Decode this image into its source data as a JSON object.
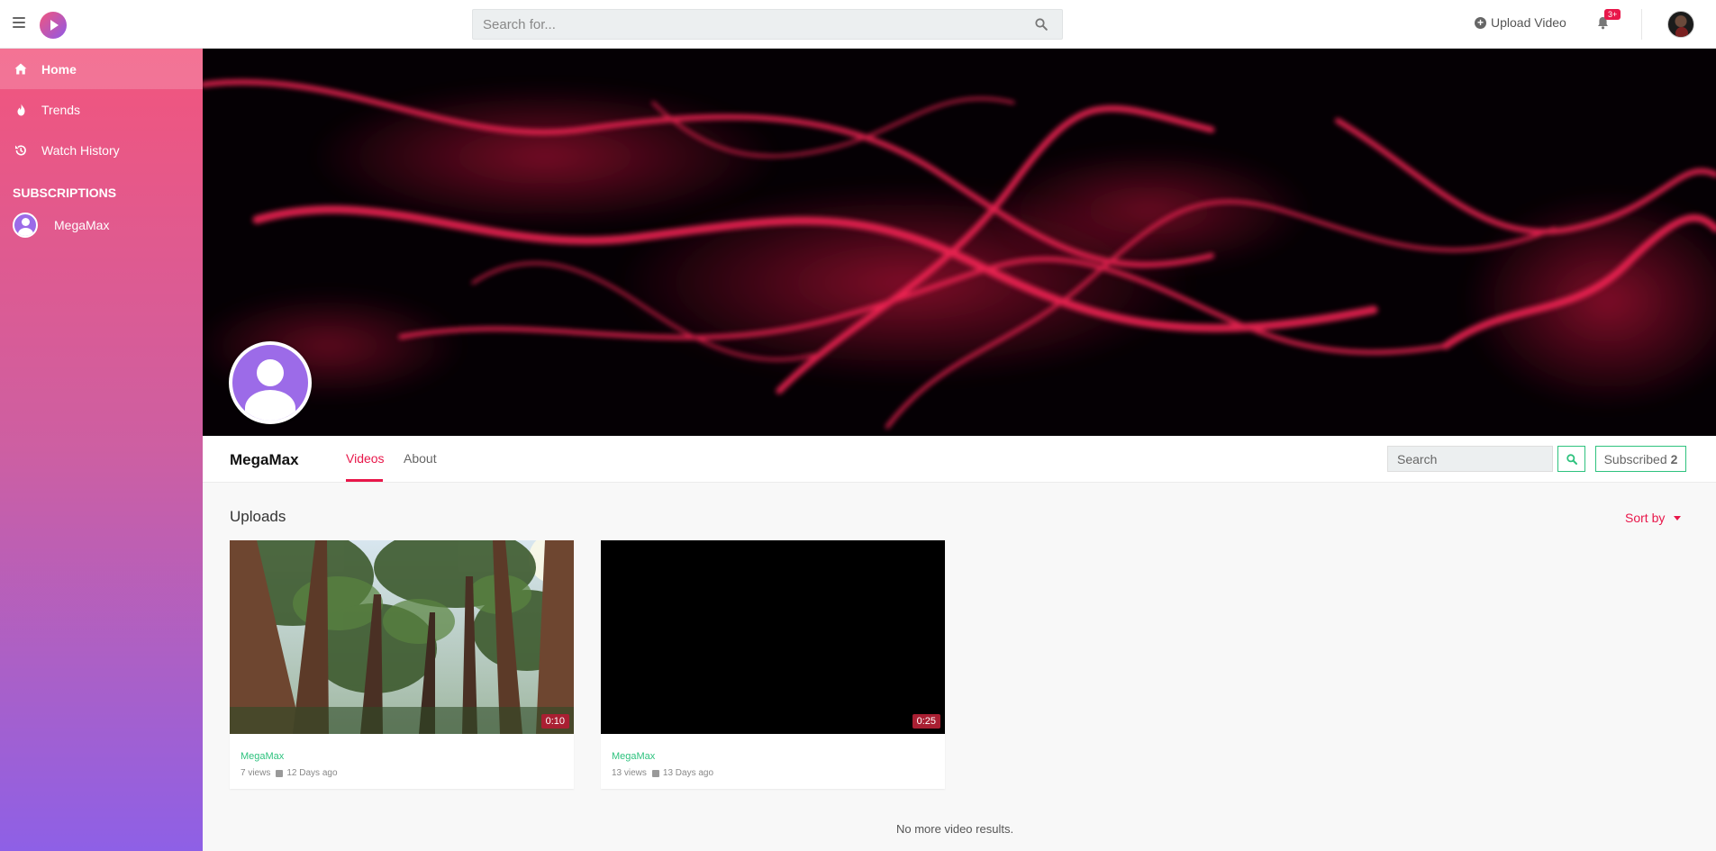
{
  "topbar": {
    "search_placeholder": "Search for...",
    "upload_label": "Upload Video",
    "notification_badge": "3+"
  },
  "sidebar": {
    "items": [
      {
        "label": "Home",
        "icon": "home-icon",
        "active": true
      },
      {
        "label": "Trends",
        "icon": "fire-icon",
        "active": false
      },
      {
        "label": "Watch History",
        "icon": "history-icon",
        "active": false
      }
    ],
    "subscriptions_heading": "SUBSCRIPTIONS",
    "subscriptions": [
      {
        "name": "MegaMax"
      }
    ]
  },
  "channel": {
    "name": "MegaMax",
    "tabs": [
      {
        "label": "Videos",
        "active": true
      },
      {
        "label": "About",
        "active": false
      }
    ],
    "search_placeholder": "Search",
    "subscribed_label": "Subscribed",
    "subscriber_count": "2"
  },
  "uploads": {
    "title": "Uploads",
    "sort_label": "Sort by",
    "videos": [
      {
        "duration": "0:10",
        "channel": "MegaMax",
        "views": "7 views",
        "date": "12 Days ago"
      },
      {
        "duration": "0:25",
        "channel": "MegaMax",
        "views": "13 views",
        "date": "13 Days ago"
      }
    ],
    "end_message": "No more video results."
  },
  "colors": {
    "accent": "#e8174a",
    "green": "#2ec27e",
    "sidebar_top": "#f2557d",
    "sidebar_bottom": "#8e60e6"
  }
}
